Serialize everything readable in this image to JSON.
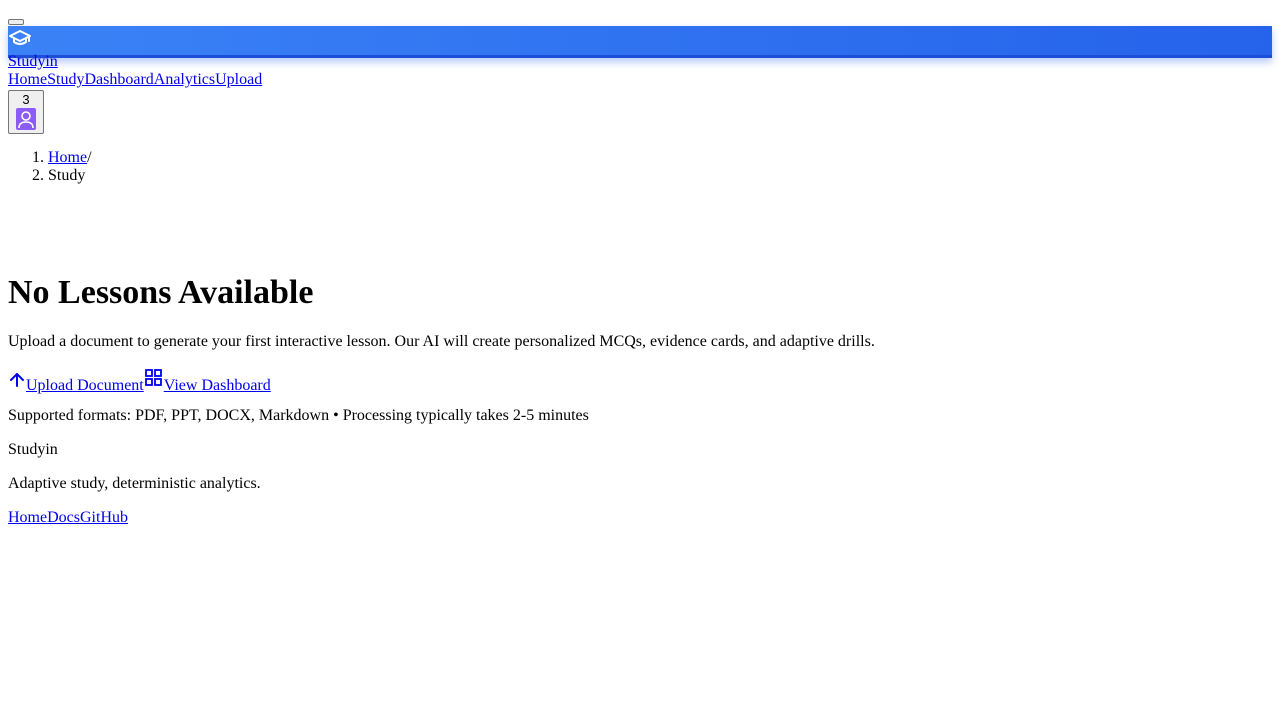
{
  "header": {
    "brand": "Studyin",
    "logo_icon": "graduation-cap-icon",
    "accent_color": "#2563eb",
    "nav": [
      "Home",
      "Study",
      "Dashboard",
      "Analytics",
      "Upload"
    ],
    "notification_count": "3",
    "avatar_color": "#8b5cf6"
  },
  "breadcrumb": {
    "items": [
      "Home",
      "/",
      "Study"
    ]
  },
  "empty_state": {
    "title": "No Lessons Available",
    "description": "Upload a document to generate your first interactive lesson. Our AI will create personalized MCQs, evidence cards, and adaptive drills.",
    "upload_label": "Upload Document",
    "dashboard_label": "View Dashboard",
    "formats_note": "Supported formats: PDF, PPT, DOCX, Markdown • Processing typically takes 2-5 minutes"
  },
  "footer": {
    "brand": "Studyin",
    "tagline": "Adaptive study, deterministic analytics.",
    "links": [
      "Home",
      "Docs",
      "GitHub"
    ]
  }
}
